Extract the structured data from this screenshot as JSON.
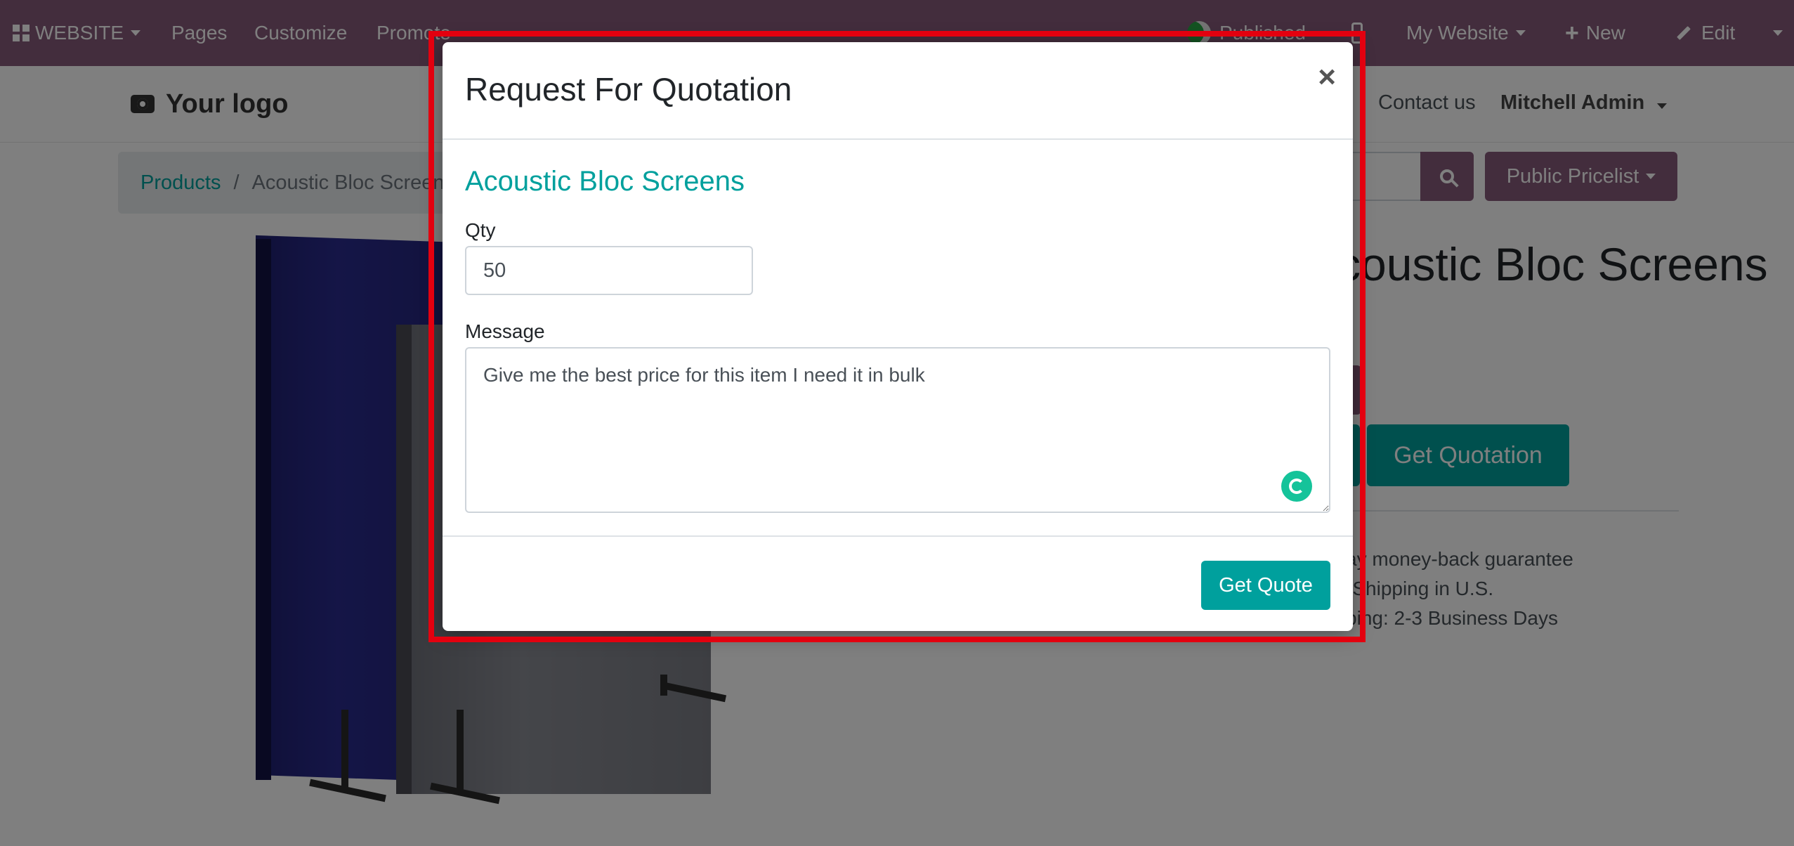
{
  "topbar": {
    "website": "WEBSITE",
    "pages": "Pages",
    "customize": "Customize",
    "promote": "Promote",
    "published": "Published",
    "my_website": "My Website",
    "new": "New",
    "edit": "Edit"
  },
  "header": {
    "logo": "Your logo",
    "contact": "Contact us",
    "user": "Mitchell Admin"
  },
  "breadcrumb": {
    "products": "Products",
    "separator": "/",
    "current": "Acoustic Bloc Screens"
  },
  "tools": {
    "pricelist": "Public Pricelist"
  },
  "product": {
    "title": "Acoustic Bloc Screens",
    "get_quotation": "Get Quotation",
    "info": [
      "30-day money-back guarantee",
      "Shipping: 2-3 Business Days",
      "Free Shipping in U.S."
    ]
  },
  "modal": {
    "title": "Request For Quotation",
    "close": "×",
    "product_name": "Acoustic Bloc Screens",
    "qty_label": "Qty",
    "qty_value": "50",
    "message_label": "Message",
    "message_value": "Give me the best price for this item I need it in bulk",
    "submit": "Get Quote"
  },
  "colors": {
    "odoo_purple": "#875a7b",
    "teal": "#00a09d",
    "annotation_red": "#e3000f"
  }
}
